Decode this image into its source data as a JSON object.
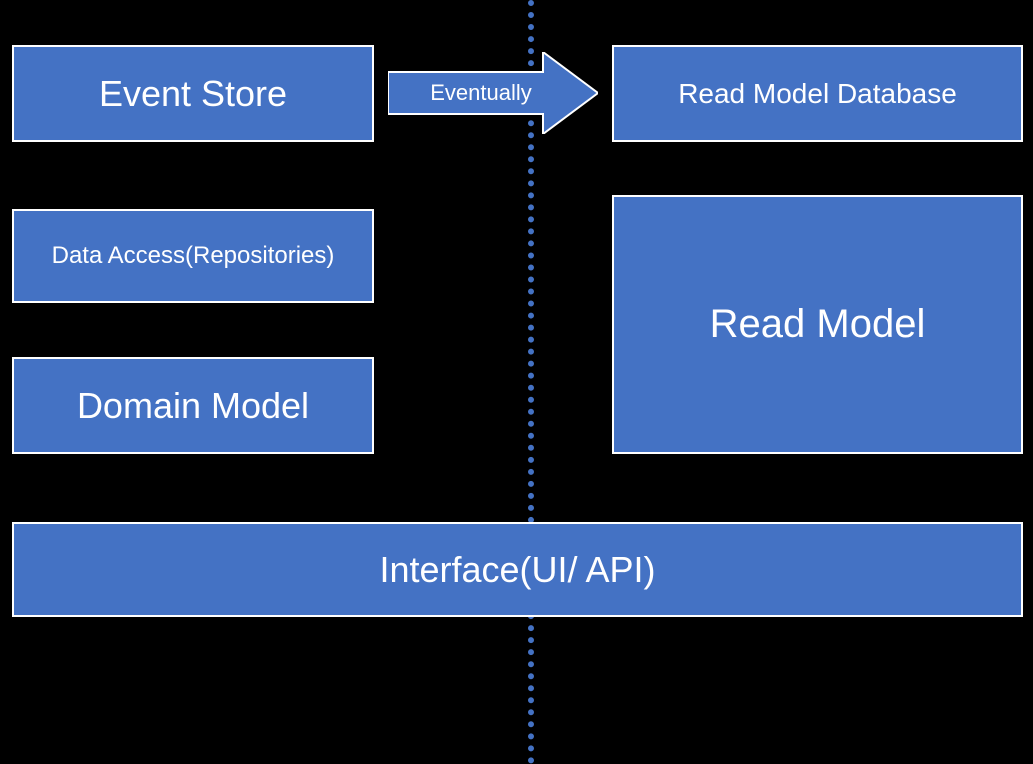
{
  "boxes": {
    "event_store": "Event Store",
    "data_access": "Data Access(Repositories)",
    "domain_model": "Domain Model",
    "read_model_db": "Read Model Database",
    "read_model": "Read Model",
    "interface": "Interface(UI/ API)"
  },
  "arrow": {
    "label": "Eventually"
  },
  "colors": {
    "box_fill": "#4472C4",
    "box_border": "#ffffff",
    "text": "#ffffff",
    "background": "#000000",
    "divider": "#4472C4"
  }
}
